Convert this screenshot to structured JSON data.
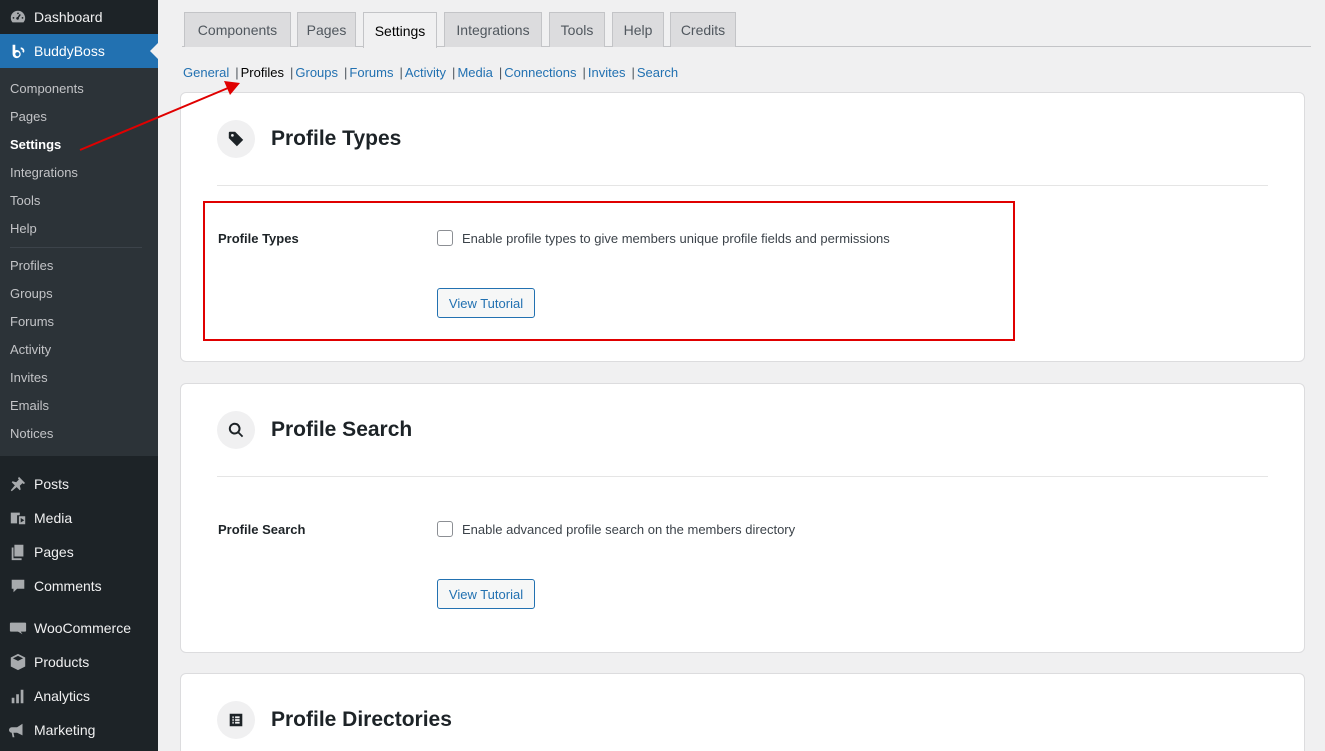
{
  "sidebar": {
    "top_items": [
      {
        "label": "Dashboard",
        "icon": "dashboard-icon"
      },
      {
        "label": "BuddyBoss",
        "icon": "buddyboss-icon"
      }
    ],
    "submenu_group1": [
      "Components",
      "Pages",
      "Settings",
      "Integrations",
      "Tools",
      "Help"
    ],
    "submenu_group2": [
      "Profiles",
      "Groups",
      "Forums",
      "Activity",
      "Invites",
      "Emails",
      "Notices"
    ],
    "bottom_items": [
      {
        "label": "Posts",
        "icon": "pin-icon"
      },
      {
        "label": "Media",
        "icon": "media-icon"
      },
      {
        "label": "Pages",
        "icon": "pages-icon"
      },
      {
        "label": "Comments",
        "icon": "comments-icon"
      },
      {
        "label": "WooCommerce",
        "icon": "woocommerce-icon"
      },
      {
        "label": "Products",
        "icon": "products-icon"
      },
      {
        "label": "Analytics",
        "icon": "analytics-icon"
      },
      {
        "label": "Marketing",
        "icon": "megaphone-icon"
      }
    ],
    "accent_color": "#2271b1"
  },
  "tabs": [
    "Components",
    "Pages",
    "Settings",
    "Integrations",
    "Tools",
    "Help",
    "Credits"
  ],
  "active_tab": "Settings",
  "subnav": [
    "General",
    "Profiles",
    "Groups",
    "Forums",
    "Activity",
    "Media",
    "Connections",
    "Invites",
    "Search"
  ],
  "active_subnav": "Profiles",
  "cards": [
    {
      "title": "Profile Types",
      "icon": "tag-icon",
      "row_label": "Profile Types",
      "checkbox_label": "Enable profile types to give members unique profile fields and permissions",
      "checked": false,
      "button": "View Tutorial"
    },
    {
      "title": "Profile Search",
      "icon": "search-icon",
      "row_label": "Profile Search",
      "checkbox_label": "Enable advanced profile search on the members directory",
      "checked": false,
      "button": "View Tutorial"
    },
    {
      "title": "Profile Directories",
      "icon": "list-icon"
    }
  ],
  "annotation_color": "#e00000"
}
